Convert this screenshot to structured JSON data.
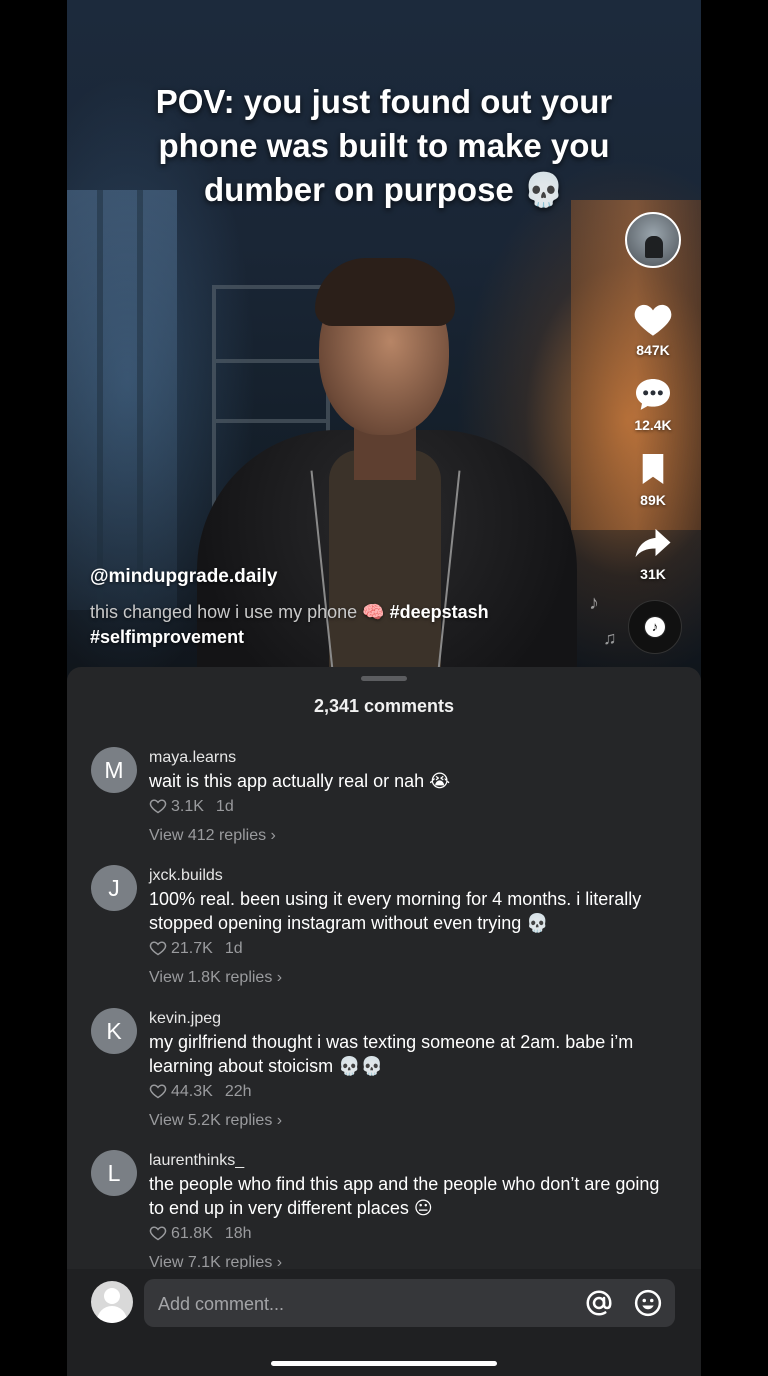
{
  "video": {
    "overlay_title": "POV: you just found out your phone was built to make you dumber on purpose 💀",
    "username": "@mindupgrade.daily",
    "caption_text": "this changed how i use my phone 🧠",
    "hashtags": [
      "#deepstash",
      "#selfimprovement"
    ]
  },
  "rail": {
    "likes": "847K",
    "comments": "12.4K",
    "saves": "89K",
    "shares": "31K",
    "icons": [
      "profile-avatar",
      "heart-icon",
      "comment-bubble-icon",
      "bookmark-icon",
      "share-arrow-icon",
      "music-disc-icon"
    ]
  },
  "comments_sheet": {
    "title": "2,341 comments",
    "comments": [
      {
        "initial": "M",
        "user": "maya.learns",
        "text": "wait is this app actually real or nah 😭",
        "likes": "3.1K",
        "time": "1d",
        "replies": "View 412 replies"
      },
      {
        "initial": "J",
        "user": "jxck.builds",
        "text": "100% real. been using it every morning for 4 months. i literally stopped opening instagram without even trying 💀",
        "likes": "21.7K",
        "time": "1d",
        "replies": "View 1.8K replies"
      },
      {
        "initial": "K",
        "user": "kevin.jpeg",
        "text": "my girlfriend thought i was texting someone at 2am. babe i’m learning about stoicism 💀💀",
        "likes": "44.3K",
        "time": "22h",
        "replies": "View 5.2K replies"
      },
      {
        "initial": "L",
        "user": "laurenthinks_",
        "text": "the people who find this app and the people who don’t are going to end up in very different places 😐",
        "likes": "61.8K",
        "time": "18h",
        "replies": "View 7.1K replies"
      }
    ]
  },
  "composer": {
    "placeholder": "Add comment...",
    "icons": [
      "at-mention-icon",
      "emoji-icon"
    ]
  },
  "colors": {
    "sheet_bg": "#252628",
    "muted_text": "#9a9b9e",
    "avatar_grey": "#7a7f85"
  }
}
